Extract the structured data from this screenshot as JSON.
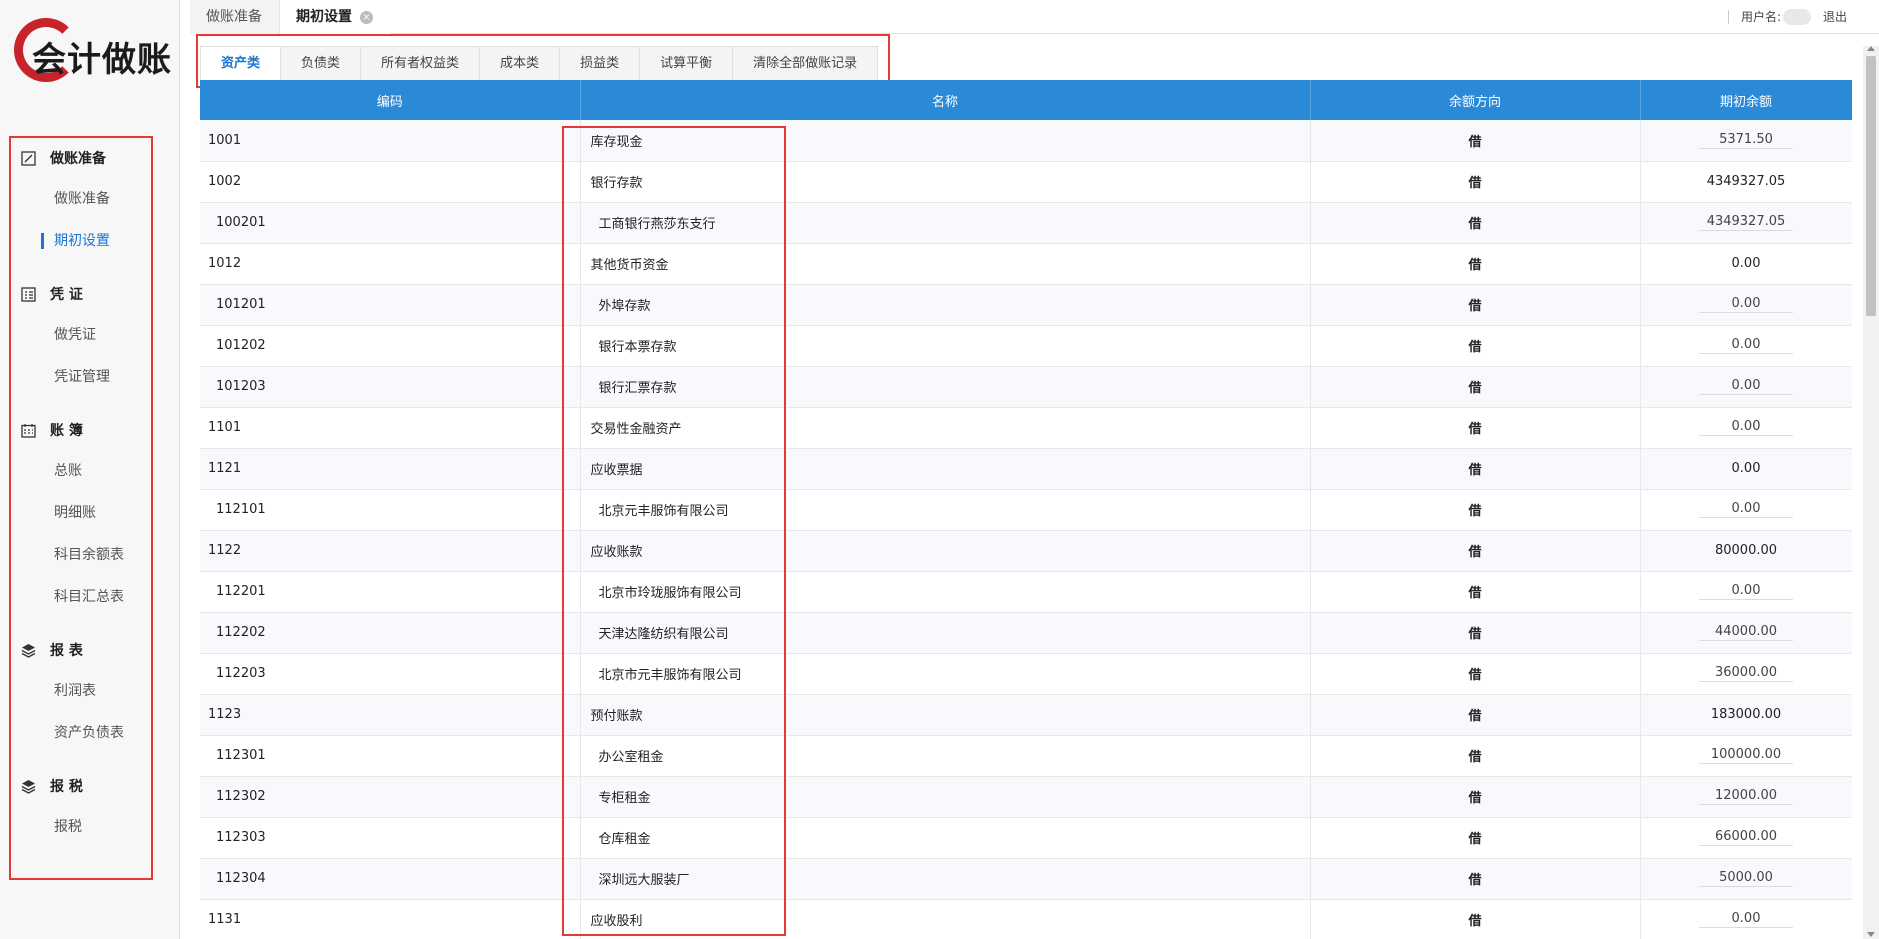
{
  "logo": {
    "text": "会计做账"
  },
  "top_tabs": [
    {
      "label": "做账准备"
    },
    {
      "label": "期初设置"
    }
  ],
  "user": {
    "label": "用户名:",
    "logout": "退出"
  },
  "sidebar": {
    "groups": [
      {
        "title": "做账准备",
        "icon": "edit-icon",
        "items": [
          "做账准备",
          "期初设置"
        ]
      },
      {
        "title": "凭 证",
        "icon": "list-icon",
        "items": [
          "做凭证",
          "凭证管理"
        ]
      },
      {
        "title": "账 簿",
        "icon": "calendar-icon",
        "items": [
          "总账",
          "明细账",
          "科目余额表",
          "科目汇总表"
        ]
      },
      {
        "title": "报 表",
        "icon": "layers-icon",
        "items": [
          "利润表",
          "资产负债表"
        ]
      },
      {
        "title": "报 税",
        "icon": "layers-icon",
        "items": [
          "报税"
        ]
      }
    ],
    "active_item": "期初设置"
  },
  "sub_tabs": [
    "资产类",
    "负债类",
    "所有者权益类",
    "成本类",
    "损益类",
    "试算平衡",
    "清除全部做账记录"
  ],
  "table": {
    "headers": [
      "编码",
      "名称",
      "余额方向",
      "期初余额"
    ],
    "rows": [
      {
        "code": "1001",
        "name": "库存现金",
        "dir": "借",
        "bal": "5371.50",
        "sub": false,
        "input": true
      },
      {
        "code": "1002",
        "name": "银行存款",
        "dir": "借",
        "bal": "4349327.05",
        "sub": false,
        "input": false
      },
      {
        "code": "100201",
        "name": "工商银行燕莎东支行",
        "dir": "借",
        "bal": "4349327.05",
        "sub": true,
        "input": true
      },
      {
        "code": "1012",
        "name": "其他货币资金",
        "dir": "借",
        "bal": "0.00",
        "sub": false,
        "input": false
      },
      {
        "code": "101201",
        "name": "外埠存款",
        "dir": "借",
        "bal": "0.00",
        "sub": true,
        "input": true
      },
      {
        "code": "101202",
        "name": "银行本票存款",
        "dir": "借",
        "bal": "0.00",
        "sub": true,
        "input": true
      },
      {
        "code": "101203",
        "name": "银行汇票存款",
        "dir": "借",
        "bal": "0.00",
        "sub": true,
        "input": true
      },
      {
        "code": "1101",
        "name": "交易性金融资产",
        "dir": "借",
        "bal": "0.00",
        "sub": false,
        "input": true
      },
      {
        "code": "1121",
        "name": "应收票据",
        "dir": "借",
        "bal": "0.00",
        "sub": false,
        "input": false
      },
      {
        "code": "112101",
        "name": "北京元丰服饰有限公司",
        "dir": "借",
        "bal": "0.00",
        "sub": true,
        "input": true
      },
      {
        "code": "1122",
        "name": "应收账款",
        "dir": "借",
        "bal": "80000.00",
        "sub": false,
        "input": false
      },
      {
        "code": "112201",
        "name": "北京市玲珑服饰有限公司",
        "dir": "借",
        "bal": "0.00",
        "sub": true,
        "input": true
      },
      {
        "code": "112202",
        "name": "天津达隆纺织有限公司",
        "dir": "借",
        "bal": "44000.00",
        "sub": true,
        "input": true
      },
      {
        "code": "112203",
        "name": "北京市元丰服饰有限公司",
        "dir": "借",
        "bal": "36000.00",
        "sub": true,
        "input": true
      },
      {
        "code": "1123",
        "name": "预付账款",
        "dir": "借",
        "bal": "183000.00",
        "sub": false,
        "input": false
      },
      {
        "code": "112301",
        "name": "办公室租金",
        "dir": "借",
        "bal": "100000.00",
        "sub": true,
        "input": true
      },
      {
        "code": "112302",
        "name": "专柜租金",
        "dir": "借",
        "bal": "12000.00",
        "sub": true,
        "input": true
      },
      {
        "code": "112303",
        "name": "仓库租金",
        "dir": "借",
        "bal": "66000.00",
        "sub": true,
        "input": true
      },
      {
        "code": "112304",
        "name": "深圳远大服装厂",
        "dir": "借",
        "bal": "5000.00",
        "sub": true,
        "input": true
      },
      {
        "code": "1131",
        "name": "应收股利",
        "dir": "借",
        "bal": "0.00",
        "sub": false,
        "input": true
      }
    ]
  },
  "colors": {
    "accent": "#1976d2",
    "header": "#2b8ad8",
    "highlight": "#e53935"
  }
}
